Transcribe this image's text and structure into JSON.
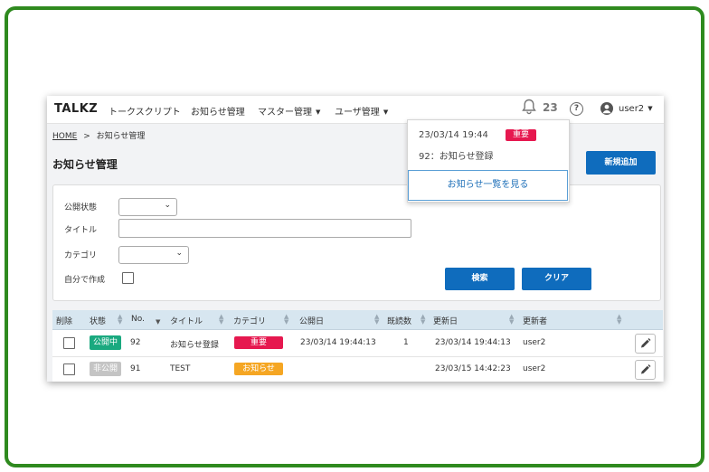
{
  "app": {
    "logo": "TALKZ",
    "user": "user2",
    "notification_count": "23"
  },
  "nav": {
    "items": [
      "トークスクリプト",
      "お知らせ管理",
      "マスター管理",
      "ユーザ管理"
    ]
  },
  "breadcrumb": {
    "home": "HOME",
    "sep": ">",
    "current": "お知らせ管理"
  },
  "page": {
    "title": "お知らせ管理",
    "add_button": "新規追加"
  },
  "filters": {
    "status_label": "公開状態",
    "title_label": "タイトル",
    "category_label": "カテゴリ",
    "mine_label": "自分で作成",
    "search_button": "検索",
    "clear_button": "クリア"
  },
  "table": {
    "headers": [
      "削除",
      "状態",
      "No.",
      "タイトル",
      "カテゴリ",
      "公開日",
      "既読数",
      "更新日",
      "更新者"
    ],
    "rows": [
      {
        "status": "公開中",
        "no": "92",
        "title": "お知らせ登録",
        "category": "重要",
        "published": "23/03/14 19:44:13",
        "reads": "1",
        "updated": "23/03/14 19:44:13",
        "updater": "user2"
      },
      {
        "status": "非公開",
        "no": "91",
        "title": "TEST",
        "category": "お知らせ",
        "published": "",
        "reads": "",
        "updated": "23/03/15 14:42:23",
        "updater": "user2"
      }
    ]
  },
  "notification": {
    "date": "23/03/14 19:44",
    "badge": "重要",
    "message": "92：お知らせ登録",
    "view_all": "お知らせ一覧を見る"
  },
  "colors": {
    "brand": "#0f6cbd",
    "important": "#e6184f",
    "notice": "#f5a623",
    "published": "#1aa97f",
    "unpublished": "#c4c4c4",
    "frame": "#2f8a1f"
  }
}
